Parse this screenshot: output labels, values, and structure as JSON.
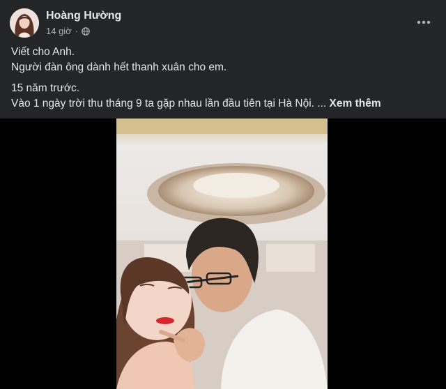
{
  "post": {
    "author": "Hoàng Hường",
    "time": "14 giờ",
    "separator": "·",
    "privacy_icon": "globe-icon",
    "more_icon": "more-horizontal-icon",
    "text_lines": [
      "Viết cho Anh.",
      "Người đàn ông dành hết thanh xuân cho em.",
      "15 năm trước.",
      "Vào 1 ngày trời thu tháng 9 ta gặp nhau lần đầu tiên tại Hà Nội. ..."
    ],
    "see_more": "Xem thêm"
  },
  "colors": {
    "background": "#242526",
    "text_primary": "#e4e6eb",
    "text_secondary": "#b0b3b8",
    "media_background": "#000000"
  }
}
